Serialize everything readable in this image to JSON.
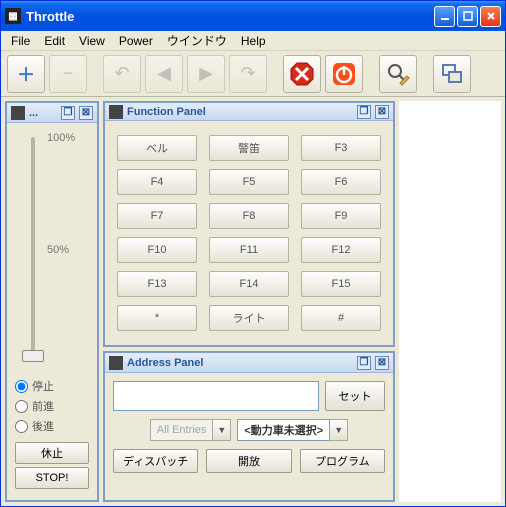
{
  "window": {
    "title": "Throttle"
  },
  "menu": {
    "file": "File",
    "edit": "Edit",
    "view": "View",
    "power": "Power",
    "window": "ウインドウ",
    "help": "Help"
  },
  "toolbar": {
    "add": "＋",
    "remove": "−",
    "glyphs": {
      "undo": "↶",
      "back": "◀",
      "forward": "▶",
      "redo": "↷"
    }
  },
  "speed": {
    "title": "...",
    "tick100": "100%",
    "tick50": "50%",
    "dir": {
      "stop": "停止",
      "forward": "前進",
      "reverse": "後進"
    },
    "idle": "休止",
    "estop": "STOP!"
  },
  "function_panel": {
    "title": "Function Panel",
    "buttons": [
      "ベル",
      "警笛",
      "F3",
      "F4",
      "F5",
      "F6",
      "F7",
      "F8",
      "F9",
      "F10",
      "F11",
      "F12",
      "F13",
      "F14",
      "F15",
      "*",
      "ライト",
      "#"
    ]
  },
  "address_panel": {
    "title": "Address Panel",
    "set": "セット",
    "all_entries": "All Entries",
    "no_loco": "<動力車未選択>",
    "dispatch": "ディスパッチ",
    "release": "開放",
    "program": "プログラム"
  }
}
